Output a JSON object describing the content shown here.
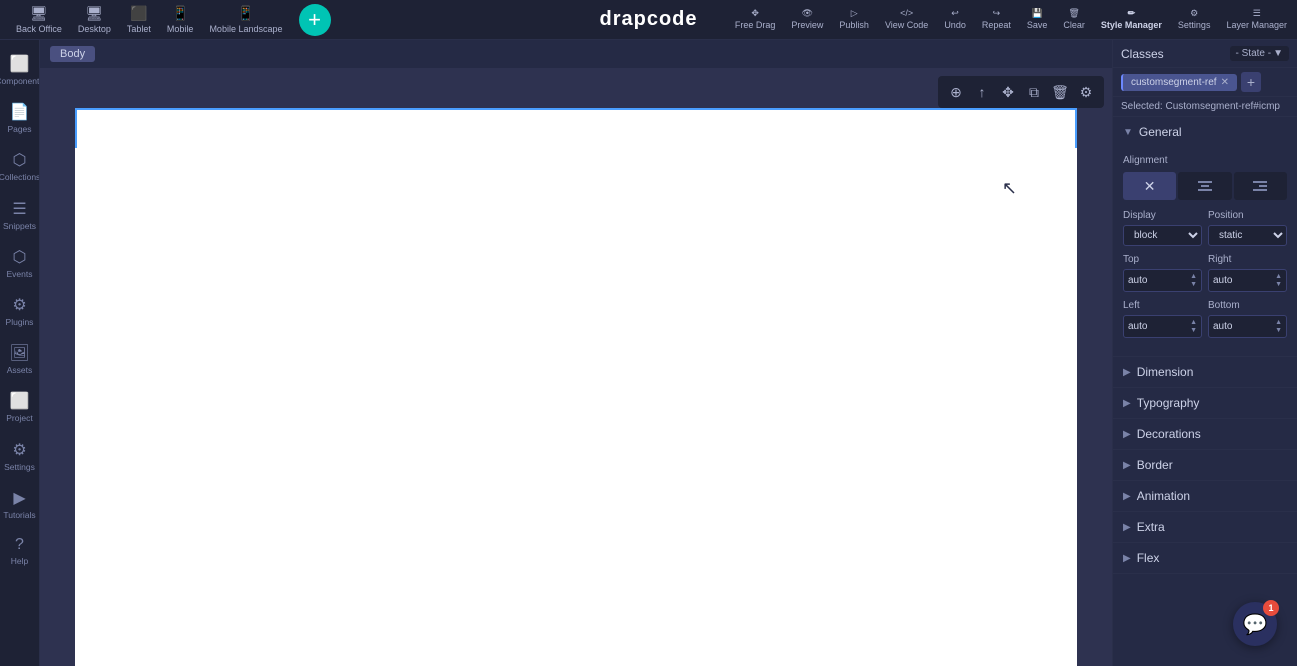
{
  "topbar": {
    "logo": "drapcode",
    "devices": [
      {
        "id": "back-office",
        "label": "Back Office",
        "icon": "🖥"
      },
      {
        "id": "desktop",
        "label": "Desktop",
        "icon": "🖥"
      },
      {
        "id": "tablet",
        "label": "Tablet",
        "icon": "⬜"
      },
      {
        "id": "mobile",
        "label": "Mobile",
        "icon": "📱"
      },
      {
        "id": "mobile-landscape",
        "label": "Mobile Landscape",
        "icon": "📱"
      }
    ],
    "add_btn_label": "+",
    "nav_items": [
      {
        "id": "free-drag",
        "label": "Free Drag",
        "icon": "✥"
      },
      {
        "id": "preview",
        "label": "Preview",
        "icon": "👁"
      },
      {
        "id": "publish",
        "label": "Publish",
        "icon": "▶"
      },
      {
        "id": "view-code",
        "label": "View Code",
        "icon": "</>"
      },
      {
        "id": "undo",
        "label": "Undo",
        "icon": "↩"
      },
      {
        "id": "redo",
        "label": "Repeat",
        "icon": "↪"
      },
      {
        "id": "save",
        "label": "Save",
        "icon": "💾"
      },
      {
        "id": "clear",
        "label": "Clear",
        "icon": "🗑"
      },
      {
        "id": "style-manager",
        "label": "Style Manager",
        "icon": "✏"
      },
      {
        "id": "settings",
        "label": "Settings",
        "icon": "⚙"
      },
      {
        "id": "layer-manager",
        "label": "Layer Manager",
        "icon": "☰"
      }
    ]
  },
  "breadcrumb": {
    "items": [
      {
        "label": "Body",
        "active": false
      }
    ]
  },
  "canvas": {
    "toolbar_buttons": [
      {
        "id": "add",
        "icon": "⊕"
      },
      {
        "id": "move-up",
        "icon": "↑"
      },
      {
        "id": "move",
        "icon": "✥"
      },
      {
        "id": "duplicate",
        "icon": "⧉"
      },
      {
        "id": "delete",
        "icon": "🗑"
      },
      {
        "id": "settings",
        "icon": "⚙"
      }
    ]
  },
  "sidebar": {
    "items": [
      {
        "id": "components",
        "label": "Components",
        "icon": "⬜"
      },
      {
        "id": "pages",
        "label": "Pages",
        "icon": "📄"
      },
      {
        "id": "collections",
        "label": "Collections",
        "icon": "⬜"
      },
      {
        "id": "snippets",
        "label": "Snippets",
        "icon": "☰"
      },
      {
        "id": "events",
        "label": "Events",
        "icon": "⬡"
      },
      {
        "id": "plugins",
        "label": "Plugins",
        "icon": "⚙"
      },
      {
        "id": "assets",
        "label": "Assets",
        "icon": "🖼"
      },
      {
        "id": "project",
        "label": "Project",
        "icon": "⬜"
      },
      {
        "id": "settings",
        "label": "Settings",
        "icon": "⚙"
      },
      {
        "id": "tutorials",
        "label": "Tutorials",
        "icon": "▶"
      },
      {
        "id": "help",
        "label": "Help",
        "icon": "?"
      }
    ]
  },
  "right_panel": {
    "classes_label": "Classes",
    "state_btn": "- State -",
    "state_chevron": "▼",
    "class_tag": "customsegment-ref",
    "selected_label": "Selected:",
    "selected_value": "Customsegment-ref#icmp",
    "sections": [
      {
        "id": "general",
        "label": "General",
        "expanded": true,
        "alignment": {
          "label": "Alignment",
          "options": [
            "✕",
            "≡",
            "≡"
          ]
        },
        "display": {
          "label": "Display",
          "value": "block"
        },
        "position": {
          "label": "Position",
          "value": "static"
        },
        "top": {
          "label": "Top",
          "value": "auto"
        },
        "right": {
          "label": "Right",
          "value": "auto"
        },
        "left": {
          "label": "Left",
          "value": "auto"
        },
        "bottom": {
          "label": "Bottom",
          "value": "auto"
        }
      },
      {
        "id": "dimension",
        "label": "Dimension",
        "expanded": false
      },
      {
        "id": "typography",
        "label": "Typography",
        "expanded": false
      },
      {
        "id": "decorations",
        "label": "Decorations",
        "expanded": false
      },
      {
        "id": "border",
        "label": "Border",
        "expanded": false
      },
      {
        "id": "animation",
        "label": "Animation",
        "expanded": false
      },
      {
        "id": "extra",
        "label": "Extra",
        "expanded": false
      },
      {
        "id": "flex",
        "label": "Flex",
        "expanded": false
      }
    ],
    "chat": {
      "icon": "💬",
      "badge": "1"
    }
  }
}
